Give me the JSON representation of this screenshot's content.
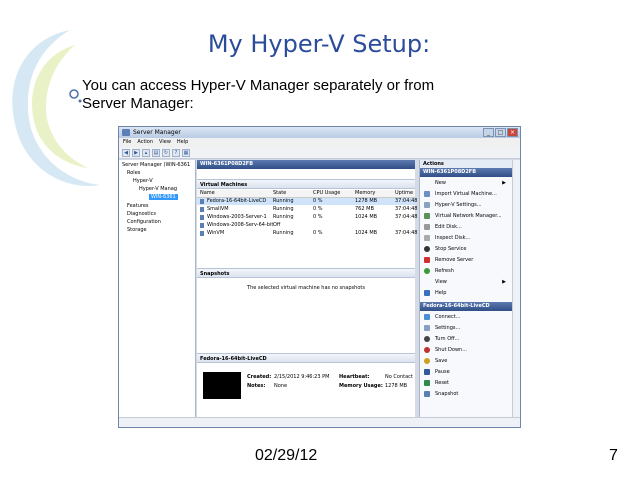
{
  "slide": {
    "title": "My Hyper-V Setup:",
    "body": "You can access Hyper-V Manager separately or from Server Manager:",
    "date": "02/29/12",
    "page": "7"
  },
  "window": {
    "title": "Server Manager",
    "menu": [
      "File",
      "Action",
      "View",
      "Help"
    ]
  },
  "tree": {
    "root": "Server Manager (WIN-6361",
    "roles": "Roles",
    "hyperv": "Hyper-V",
    "manager": "Hyper-V Manag",
    "host": "WIN-6361",
    "features": "Features",
    "diagnostics": "Diagnostics",
    "configuration": "Configuration",
    "storage": "Storage"
  },
  "center": {
    "host_header": "WIN-6361P08D2FB",
    "vm_section": "Virtual Machines",
    "columns": [
      "Name",
      "State",
      "CPU Usage",
      "Memory",
      "Uptime"
    ],
    "vms": [
      {
        "name": "Fedora-16-64bit-LiveCD",
        "state": "Running",
        "cpu": "0 %",
        "mem": "1278 MB",
        "uptime": "37:04:48"
      },
      {
        "name": "SmallVM",
        "state": "Running",
        "cpu": "0 %",
        "mem": "762 MB",
        "uptime": "37:04:48"
      },
      {
        "name": "Windows-2003-Server-1",
        "state": "Running",
        "cpu": "0 %",
        "mem": "1024 MB",
        "uptime": "37:04:48"
      },
      {
        "name": "Windows-2008-Serv-64-bit",
        "state": "Off",
        "cpu": "",
        "mem": "",
        "uptime": ""
      },
      {
        "name": "WinVM",
        "state": "Running",
        "cpu": "0 %",
        "mem": "1024 MB",
        "uptime": "37:04:48"
      }
    ],
    "snap_section": "Snapshots",
    "snap_msg": "The selected virtual machine has no snapshots",
    "detail_section": "Fedora-16-64bit-LiveCD",
    "created_label": "Created:",
    "created_value": "2/15/2012 9:46:23 PM",
    "notes_label": "Notes:",
    "notes_value": "None",
    "heartbeat_label": "Heartbeat:",
    "heartbeat_value": "No Contact",
    "memusage_label": "Memory Usage:",
    "memusage_value": "1278 MB"
  },
  "actions": {
    "title": "Actions",
    "host_header": "WIN-6361P08D2FB",
    "host_items": [
      "New",
      "Import Virtual Machine...",
      "Hyper-V Settings...",
      "Virtual Network Manager...",
      "Edit Disk...",
      "Inspect Disk...",
      "Stop Service",
      "Remove Server",
      "Refresh",
      "View",
      "Help"
    ],
    "vm_header": "Fedora-16-64bit-LiveCD",
    "vm_items": [
      "Connect...",
      "Settings...",
      "Turn Off...",
      "Shut Down...",
      "Save",
      "Pause",
      "Reset",
      "Snapshot"
    ]
  }
}
